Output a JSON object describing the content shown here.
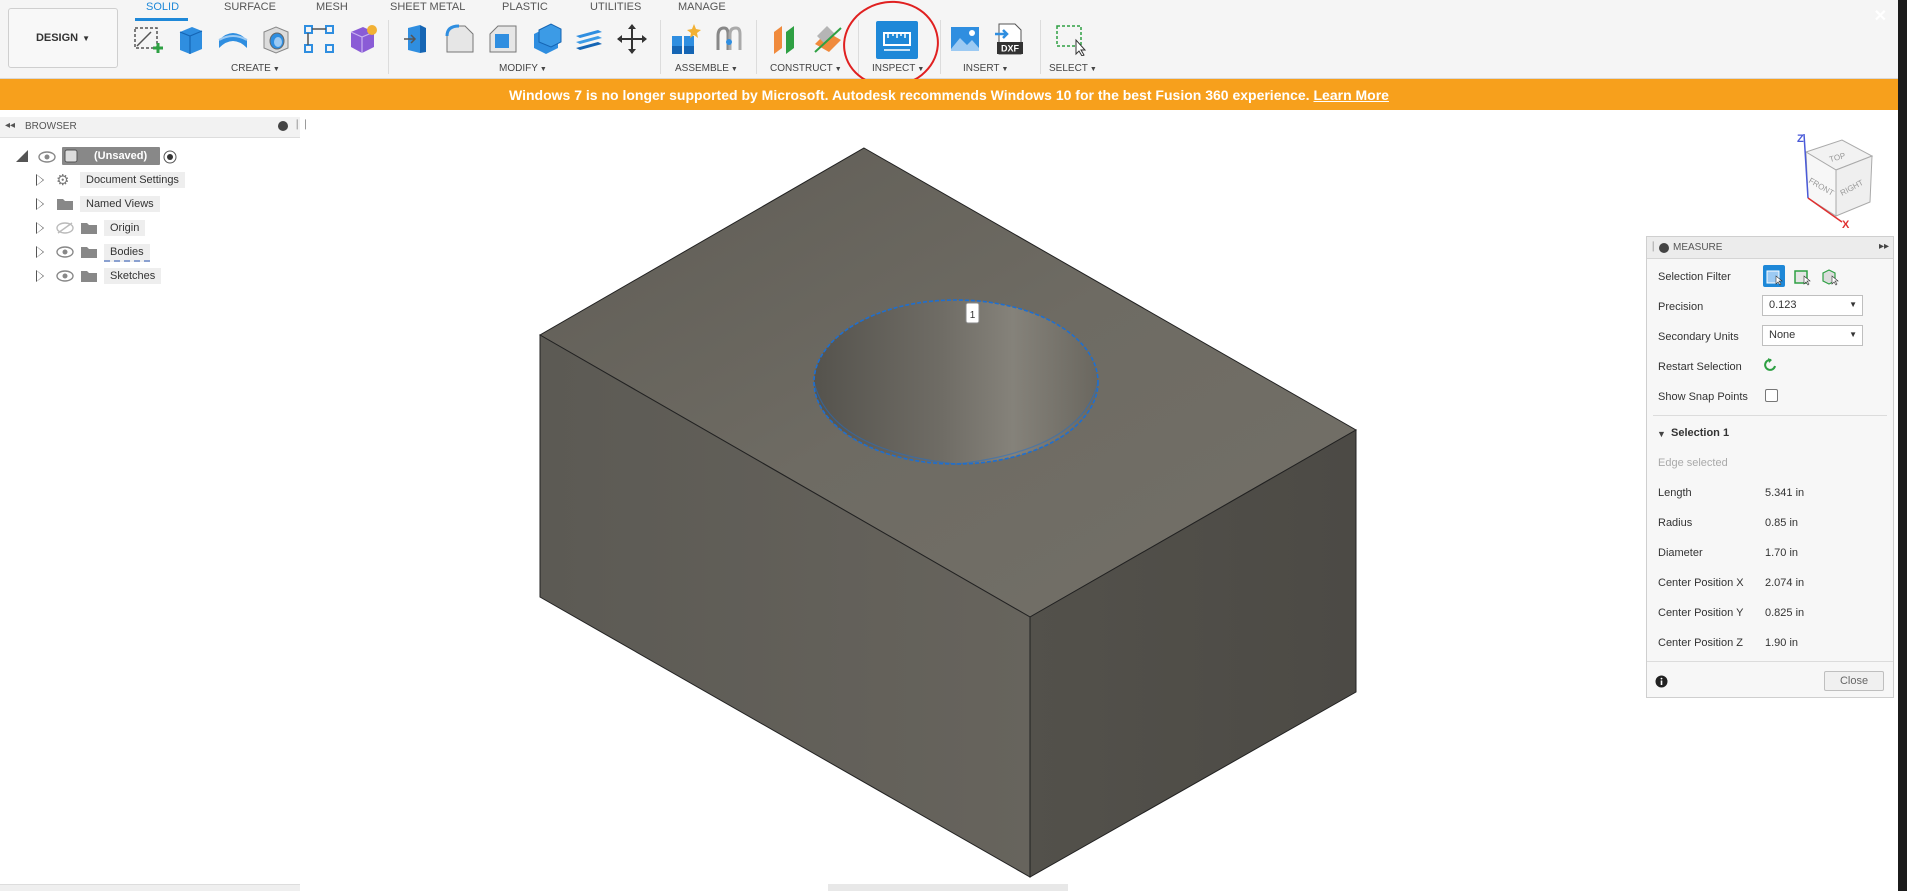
{
  "toolbar": {
    "workspace": "DESIGN",
    "tabs": [
      "SOLID",
      "SURFACE",
      "MESH",
      "SHEET METAL",
      "PLASTIC",
      "UTILITIES",
      "MANAGE"
    ],
    "groups": {
      "create": "CREATE",
      "modify": "MODIFY",
      "assemble": "ASSEMBLE",
      "construct": "CONSTRUCT",
      "inspect": "INSPECT",
      "insert": "INSERT",
      "select": "SELECT"
    },
    "dxf_label": "DXF"
  },
  "banner": {
    "message": "Windows 7 is no longer supported by Microsoft. Autodesk recommends Windows 10 for the best Fusion 360 experience.",
    "link": "Learn More",
    "close": "✕"
  },
  "browser": {
    "title": "BROWSER",
    "root": "(Unsaved)",
    "items": [
      "Document Settings",
      "Named Views",
      "Origin",
      "Bodies",
      "Sketches"
    ]
  },
  "viewport": {
    "marker": "1",
    "viewcube": {
      "top": "TOP",
      "front": "FRONT",
      "right": "RIGHT",
      "z_axis": "Z",
      "x_axis": "X"
    }
  },
  "measure": {
    "title": "MEASURE",
    "selection_filter_label": "Selection Filter",
    "precision_label": "Precision",
    "precision_value": "0.123",
    "secondary_units_label": "Secondary Units",
    "secondary_units_value": "None",
    "restart_label": "Restart Selection",
    "snap_label": "Show Snap Points",
    "selection_heading": "Selection 1",
    "edge_selected": "Edge selected",
    "results": [
      {
        "label": "Length",
        "value": "5.341 in"
      },
      {
        "label": "Radius",
        "value": "0.85 in"
      },
      {
        "label": "Diameter",
        "value": "1.70 in"
      },
      {
        "label": "Center Position X",
        "value": "2.074 in"
      },
      {
        "label": "Center Position Y",
        "value": "0.825 in"
      },
      {
        "label": "Center Position Z",
        "value": "1.90 in"
      }
    ],
    "close_label": "Close"
  },
  "colors": {
    "accent": "#1e88d8",
    "banner": "#f7a01c",
    "highlight_circle": "#e02020",
    "model_top": "#6c6961",
    "model_left": "#5f5d56",
    "model_right": "#4e4c46"
  }
}
